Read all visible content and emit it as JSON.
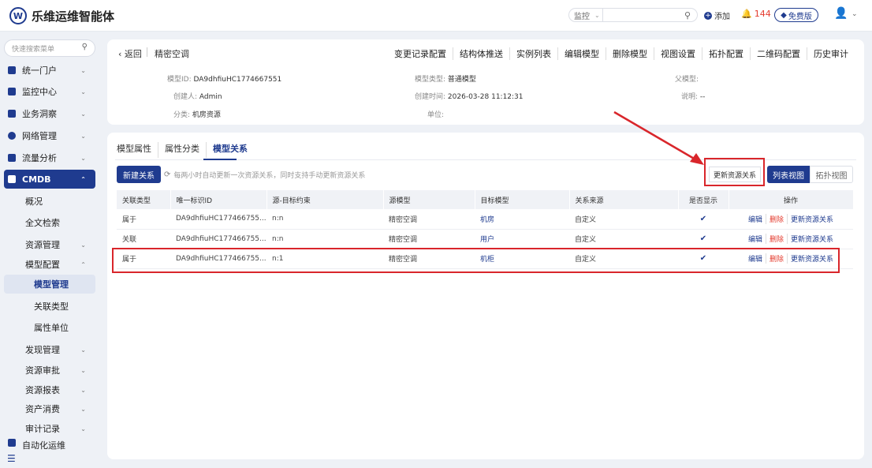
{
  "app": {
    "title": "乐维运维智能体",
    "logo_letter": "W"
  },
  "topbar": {
    "select_value": "监控",
    "add_label": "添加",
    "alert_count": "144",
    "plan_label": "免费版"
  },
  "sidebar": {
    "search_placeholder": "快速搜索菜单",
    "items": [
      {
        "label": "统一门户"
      },
      {
        "label": "监控中心"
      },
      {
        "label": "业务洞察"
      },
      {
        "label": "网络管理"
      },
      {
        "label": "流量分析"
      },
      {
        "label": "CMDB"
      }
    ],
    "cmdb_sub": [
      {
        "label": "概况"
      },
      {
        "label": "全文检索"
      },
      {
        "label": "资源管理"
      },
      {
        "label": "模型配置"
      },
      {
        "label": "模型管理"
      },
      {
        "label": "关联类型"
      },
      {
        "label": "属性单位"
      },
      {
        "label": "发现管理"
      },
      {
        "label": "资源审批"
      },
      {
        "label": "资源报表"
      },
      {
        "label": "资产消费"
      },
      {
        "label": "审计记录"
      },
      {
        "label": "自动化运维"
      }
    ]
  },
  "header": {
    "back_label": "返回",
    "model_name": "精密空调",
    "actions": [
      "变更记录配置",
      "结构体推送",
      "实例列表",
      "编辑模型",
      "删除模型",
      "视图设置",
      "拓扑配置",
      "二维码配置",
      "历史审计"
    ]
  },
  "model_info": {
    "model_id_label": "模型ID:",
    "model_id": "DA9dhfiuHC1774667551",
    "creator_label": "创建人:",
    "creator": "Admin",
    "category_label": "分类:",
    "category": "机房资源",
    "type_label": "模型类型:",
    "type": "普通模型",
    "created_label": "创建时间:",
    "created": "2026-03-28 11:12:31",
    "unit_label": "单位:",
    "unit": "",
    "parent_label": "父模型:",
    "parent": "",
    "desc_label": "说明:",
    "desc": "--"
  },
  "tabs": [
    "模型属性",
    "属性分类",
    "模型关系"
  ],
  "toolbar": {
    "new_relation": "新建关系",
    "hint": "每两小时自动更新一次资源关系，同时支持手动更新资源关系",
    "update_relation": "更新资源关系",
    "list_view": "列表视图",
    "topo_view": "拓扑视图"
  },
  "table": {
    "headers": [
      "关联类型",
      "唯一标识ID",
      "源-目标约束",
      "源模型",
      "目标模型",
      "关系来源",
      "是否显示",
      "操作"
    ],
    "rows": [
      {
        "type": "属于",
        "id": "DA9dhfiuHC177466755...",
        "constraint": "n:n",
        "source": "精密空调",
        "target": "机房",
        "origin": "自定义",
        "shown": "✔"
      },
      {
        "type": "关联",
        "id": "DA9dhfiuHC177466755...",
        "constraint": "n:n",
        "source": "精密空调",
        "target": "用户",
        "origin": "自定义",
        "shown": "✔"
      },
      {
        "type": "属于",
        "id": "DA9dhfiuHC177466755...",
        "constraint": "n:1",
        "source": "精密空调",
        "target": "机柜",
        "origin": "自定义",
        "shown": "✔"
      }
    ],
    "ops": {
      "edit": "编辑",
      "delete": "删除",
      "update": "更新资源关系"
    }
  },
  "colors": {
    "primary": "#1f3b8f",
    "danger": "#e43b2e",
    "annotation": "#d9262b"
  }
}
